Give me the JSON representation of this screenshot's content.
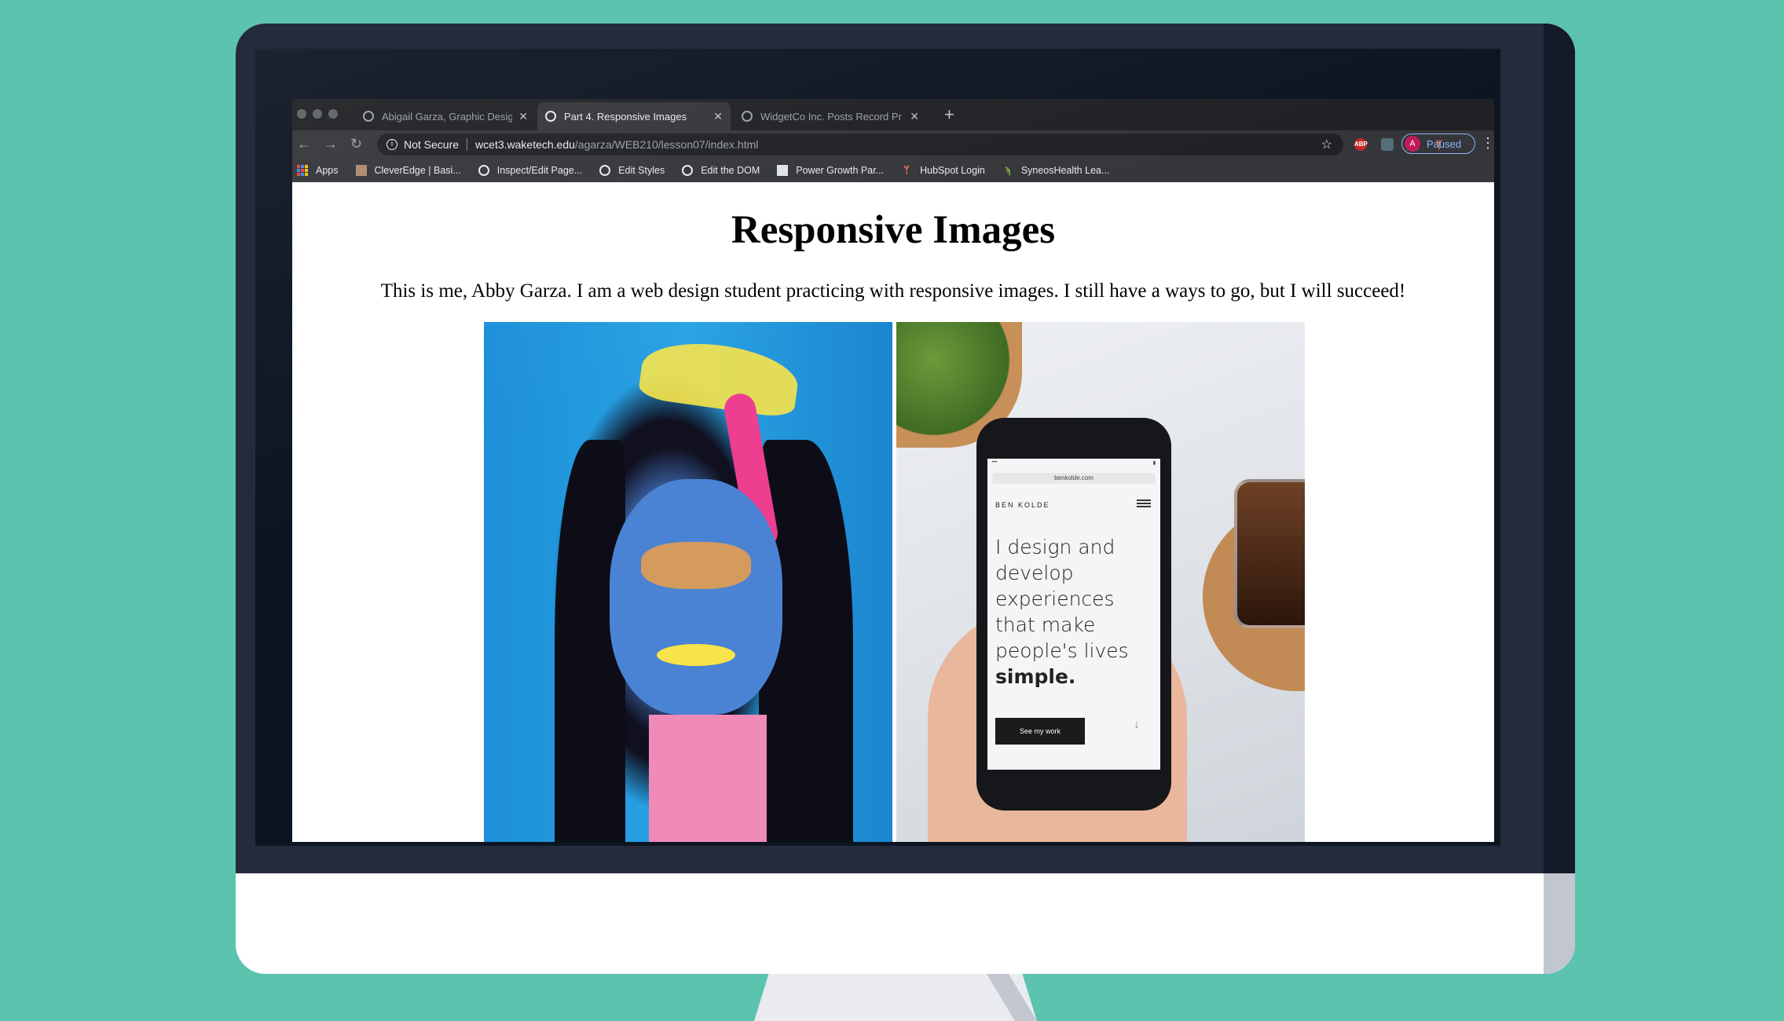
{
  "browser": {
    "tabs": [
      {
        "title": "Abigail Garza, Graphic Designer",
        "active": false
      },
      {
        "title": "Part 4. Responsive Images",
        "active": true
      },
      {
        "title": "WidgetCo Inc. Posts Record Pr",
        "active": false
      }
    ],
    "new_tab": "+",
    "nav": {
      "back": "←",
      "forward": "→",
      "reload": "↻"
    },
    "address": {
      "security_label": "Not Secure",
      "host": "wcet3.waketech.edu",
      "path": "/agarza/WEB210/lesson07/index.html"
    },
    "extensions": [
      "ABP",
      "ext",
      "ext",
      "HubSpot"
    ],
    "profile": {
      "initial": "A",
      "status": "Paused"
    },
    "bookmarks": [
      {
        "label": "Apps",
        "icon": "apps-grid-icon"
      },
      {
        "label": "CleverEdge | Basi...",
        "icon": "thumbnail-icon"
      },
      {
        "label": "Inspect/Edit Page...",
        "icon": "globe-icon"
      },
      {
        "label": "Edit Styles",
        "icon": "globe-icon"
      },
      {
        "label": "Edit the DOM",
        "icon": "globe-icon"
      },
      {
        "label": "Power Growth Par...",
        "icon": "doc-icon"
      },
      {
        "label": "HubSpot Login",
        "icon": "hubspot-icon"
      },
      {
        "label": "SyneosHealth Lea...",
        "icon": "syneos-icon"
      }
    ]
  },
  "page": {
    "heading": "Responsive Images",
    "intro": "This is me, Abby Garza. I am a web design student practicing with responsive images. I still have a ways to go, but I will succeed!"
  },
  "phone_mockup": {
    "url": "benkolde.com",
    "brand": "BEN KOLDE",
    "headline": "I design and develop experiences that make people's lives",
    "headline_bold": "simple.",
    "cta": "See my work"
  },
  "colors": {
    "background": "#5bc3ae",
    "bezel": "#242b3d",
    "tab_active": "#35363a",
    "profile_accent": "#8ab4f8"
  }
}
